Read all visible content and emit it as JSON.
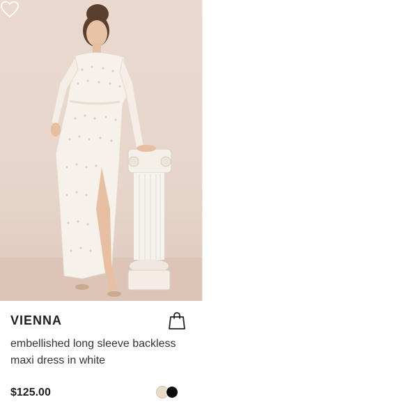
{
  "product": {
    "brand": "VIENNA",
    "title": "embellished long sleeve backless maxi dress in white",
    "price": "$125.00",
    "image_alt": "Model wearing white embellished long sleeve maxi dress beside a pillar"
  },
  "icons": {
    "wishlist": "heart-outline-icon",
    "add_to_bag": "shopping-bag-icon"
  },
  "swatches": [
    {
      "name": "cream",
      "color": "#e8dcc8"
    },
    {
      "name": "black",
      "color": "#0b0b0b"
    }
  ],
  "colors": {
    "text": "#1e1e1e",
    "photo_background": "#e8d7cd"
  }
}
